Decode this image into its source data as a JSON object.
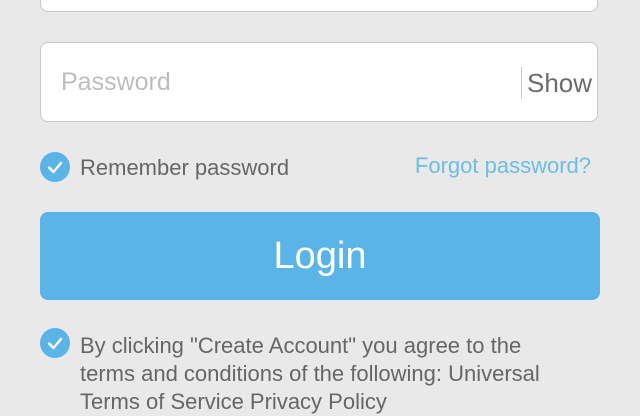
{
  "password": {
    "placeholder": "Password",
    "value": "",
    "show_label": "Show"
  },
  "remember": {
    "label": "Remember password",
    "checked": true
  },
  "forgot": {
    "label": "Forgot password?"
  },
  "login": {
    "label": "Login"
  },
  "terms": {
    "checked": true,
    "line1": "By clicking \"Create Account\" you agree to the",
    "line2": "terms and conditions of the following: Universal",
    "line3": "Terms of Service Privacy Policy"
  },
  "colors": {
    "accent": "#5ab4e8",
    "link": "#6cbde6",
    "background": "#e9e9e9"
  }
}
